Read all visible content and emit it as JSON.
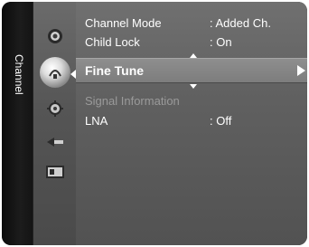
{
  "menu": {
    "side_label": "Channel",
    "icons": [
      "picture-icon",
      "channel-icon",
      "setup-icon",
      "input-icon",
      "application-icon",
      "support-icon"
    ],
    "items": [
      {
        "label": "Channel Mode",
        "value": ": Added Ch."
      },
      {
        "label": "Child Lock",
        "value": ": On"
      },
      {
        "label": "Fine Tune",
        "value": ""
      },
      {
        "label": "Signal Information",
        "value": ""
      },
      {
        "label": "LNA",
        "value": ": Off"
      }
    ],
    "selected_index": 2,
    "disabled_index": 3
  }
}
